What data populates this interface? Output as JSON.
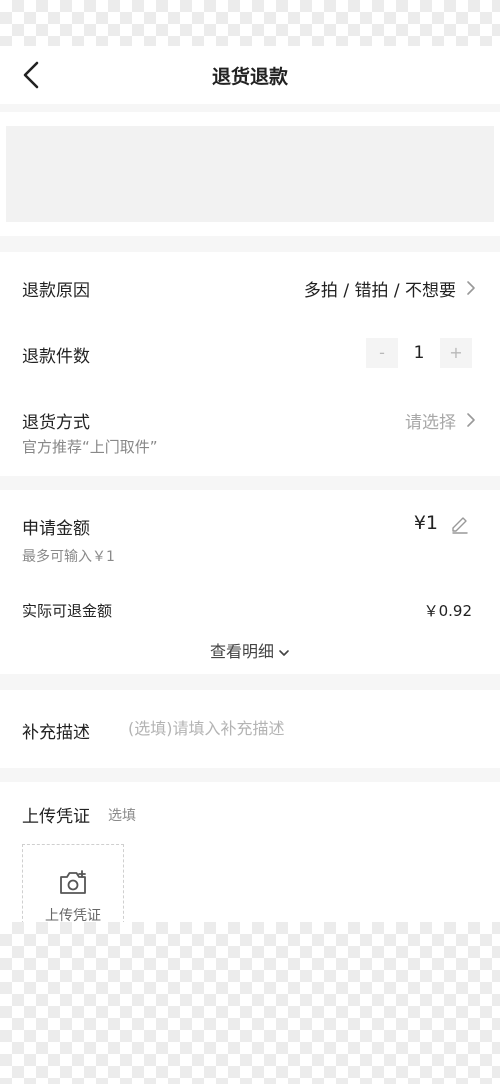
{
  "header": {
    "title": "退货退款",
    "back_icon": "chevron-left-icon"
  },
  "refund": {
    "reason_label": "退款原因",
    "reason_value": "多拍 / 错拍 / 不想要",
    "quantity_label": "退款件数",
    "quantity_value": "1",
    "minus_label": "-",
    "plus_label": "+",
    "method_label": "退货方式",
    "method_value": "请选择",
    "method_hint": "官方推荐“上门取件”"
  },
  "amount": {
    "apply_label": "申请金额",
    "apply_value": "¥1",
    "max_hint": "最多可输入￥1",
    "actual_label": "实际可退金额",
    "actual_value": "￥0.92",
    "detail_link": "查看明细"
  },
  "description": {
    "label": "补充描述",
    "placeholder": "(选填)请填入补充描述"
  },
  "upload": {
    "title": "上传凭证",
    "optional": "选填",
    "button_label": "上传凭证"
  },
  "colors": {
    "text": "#222222",
    "muted": "#a8a8a8",
    "background": "#f6f6f6"
  }
}
